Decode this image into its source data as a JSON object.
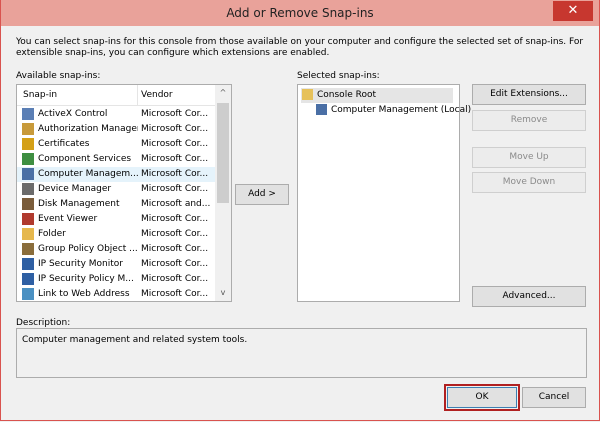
{
  "window": {
    "title": "Add or Remove Snap-ins",
    "close_glyph": "✕",
    "accent_color": "#c7372f"
  },
  "intro_text": "You can select snap-ins for this console from those available on your computer and configure the selected set of snap-ins. For extensible snap-ins, you can configure which extensions are enabled.",
  "available": {
    "label": "Available snap-ins:",
    "columns": [
      "Snap-in",
      "Vendor"
    ],
    "rows": [
      {
        "name": "ActiveX Control",
        "vendor": "Microsoft Cor...",
        "icon": "activex-icon"
      },
      {
        "name": "Authorization Manager",
        "vendor": "Microsoft Cor...",
        "icon": "authorization-icon"
      },
      {
        "name": "Certificates",
        "vendor": "Microsoft Cor...",
        "icon": "certificates-icon"
      },
      {
        "name": "Component Services",
        "vendor": "Microsoft Cor...",
        "icon": "component-services-icon"
      },
      {
        "name": "Computer Managem...",
        "vendor": "Microsoft Cor...",
        "icon": "computer-management-icon"
      },
      {
        "name": "Device Manager",
        "vendor": "Microsoft Cor...",
        "icon": "device-manager-icon"
      },
      {
        "name": "Disk Management",
        "vendor": "Microsoft and...",
        "icon": "disk-management-icon"
      },
      {
        "name": "Event Viewer",
        "vendor": "Microsoft Cor...",
        "icon": "event-viewer-icon"
      },
      {
        "name": "Folder",
        "vendor": "Microsoft Cor...",
        "icon": "folder-icon"
      },
      {
        "name": "Group Policy Object ...",
        "vendor": "Microsoft Cor...",
        "icon": "group-policy-icon"
      },
      {
        "name": "IP Security Monitor",
        "vendor": "Microsoft Cor...",
        "icon": "ip-security-monitor-icon"
      },
      {
        "name": "IP Security Policy M...",
        "vendor": "Microsoft Cor...",
        "icon": "ip-security-policy-icon"
      },
      {
        "name": "Link to Web Address",
        "vendor": "Microsoft Cor...",
        "icon": "link-icon"
      }
    ],
    "selected_index": 4,
    "scroll_up": "^",
    "scroll_down": "v"
  },
  "add_button": "Add >",
  "selected": {
    "label": "Selected snap-ins:",
    "tree": [
      {
        "name": "Console Root",
        "level": 0,
        "icon": "console-root-icon"
      },
      {
        "name": "Computer Management (Local)",
        "level": 1,
        "icon": "computer-management-icon"
      }
    ]
  },
  "buttons": {
    "edit_extensions": "Edit Extensions...",
    "remove": "Remove",
    "move_up": "Move Up",
    "move_down": "Move Down",
    "advanced": "Advanced...",
    "ok": "OK",
    "cancel": "Cancel"
  },
  "description": {
    "label": "Description:",
    "text": "Computer management and related system tools."
  }
}
